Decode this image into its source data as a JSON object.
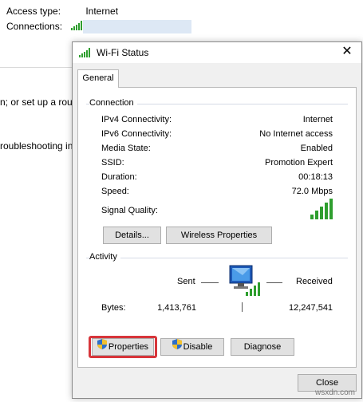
{
  "background": {
    "access_type_label": "Access type:",
    "access_type_value": "Internet",
    "connections_label": "Connections:",
    "fragment_1": "n; or set up a rout",
    "fragment_2": "roubleshooting in"
  },
  "dialog": {
    "title": "Wi-Fi Status",
    "close_label": "Close",
    "tab_general": "General",
    "connection": {
      "heading": "Connection",
      "rows": [
        {
          "label": "IPv4 Connectivity:",
          "value": "Internet"
        },
        {
          "label": "IPv6 Connectivity:",
          "value": "No Internet access"
        },
        {
          "label": "Media State:",
          "value": "Enabled"
        },
        {
          "label": "SSID:",
          "value": "Promotion Expert"
        },
        {
          "label": "Duration:",
          "value": "00:18:13"
        },
        {
          "label": "Speed:",
          "value": "72.0 Mbps"
        }
      ],
      "signal_label": "Signal Quality:",
      "details_button": "Details...",
      "wireless_button": "Wireless Properties"
    },
    "activity": {
      "heading": "Activity",
      "sent_label": "Sent",
      "received_label": "Received",
      "bytes_label": "Bytes:",
      "bytes_sent": "1,413,761",
      "bytes_received": "12,247,541"
    },
    "buttons": {
      "properties": "Properties",
      "disable": "Disable",
      "diagnose": "Diagnose"
    }
  },
  "watermark": "wsxdn.com",
  "colors": {
    "signal_green": "#2e9e2e",
    "highlight_red": "#d7353a",
    "selection_blue": "#dde8f5"
  }
}
